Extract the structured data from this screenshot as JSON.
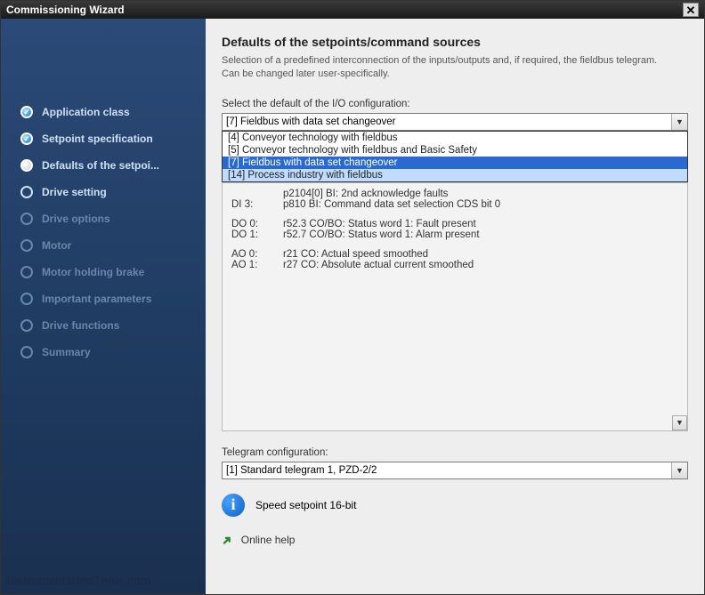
{
  "window": {
    "title": "Commissioning Wizard"
  },
  "sidebar": {
    "items": [
      {
        "label": "Application class",
        "state": "done"
      },
      {
        "label": "Setpoint specification",
        "state": "done"
      },
      {
        "label": "Defaults of the setpoi...",
        "state": "current"
      },
      {
        "label": "Drive setting",
        "state": "pending"
      },
      {
        "label": "Drive options",
        "state": "dimmed"
      },
      {
        "label": "Motor",
        "state": "dimmed"
      },
      {
        "label": "Motor holding brake",
        "state": "dimmed"
      },
      {
        "label": "Important parameters",
        "state": "dimmed"
      },
      {
        "label": "Drive functions",
        "state": "dimmed"
      },
      {
        "label": "Summary",
        "state": "dimmed"
      }
    ]
  },
  "main": {
    "heading": "Defaults of the setpoints/command sources",
    "sub": "Selection of a predefined interconnection of the inputs/outputs and, if required, the fieldbus telegram. Can be changed later user-specifically.",
    "io_label": "Select the default of the I/O configuration:",
    "io_value": "[7] Fieldbus with data set changeover",
    "io_options": [
      "[4] Conveyor technology with fieldbus",
      "[5] Conveyor technology with fieldbus and Basic Safety",
      "[7] Fieldbus with data set changeover",
      "[14] Process industry with fieldbus"
    ],
    "details": {
      "line1": {
        "tag": "",
        "text": "p2104[0] BI: 2nd acknowledge faults"
      },
      "di3": {
        "tag": "DI 3:",
        "text": "p810 BI: Command data set selection CDS bit 0"
      },
      "do0": {
        "tag": "DO 0:",
        "text": "r52.3 CO/BO: Status word 1: Fault present"
      },
      "do1": {
        "tag": "DO 1:",
        "text": "r52.7 CO/BO: Status word 1: Alarm present"
      },
      "ao0": {
        "tag": "AO 0:",
        "text": "r21 CO: Actual speed smoothed"
      },
      "ao1": {
        "tag": "AO 1:",
        "text": "r27 CO: Absolute actual current smoothed"
      }
    },
    "telegram_label": "Telegram configuration:",
    "telegram_value": "[1] Standard telegram 1, PZD-2/2",
    "info_text": "Speed setpoint 16-bit",
    "help_text": "Online help"
  },
  "watermark": "InstrumentationTools.com"
}
